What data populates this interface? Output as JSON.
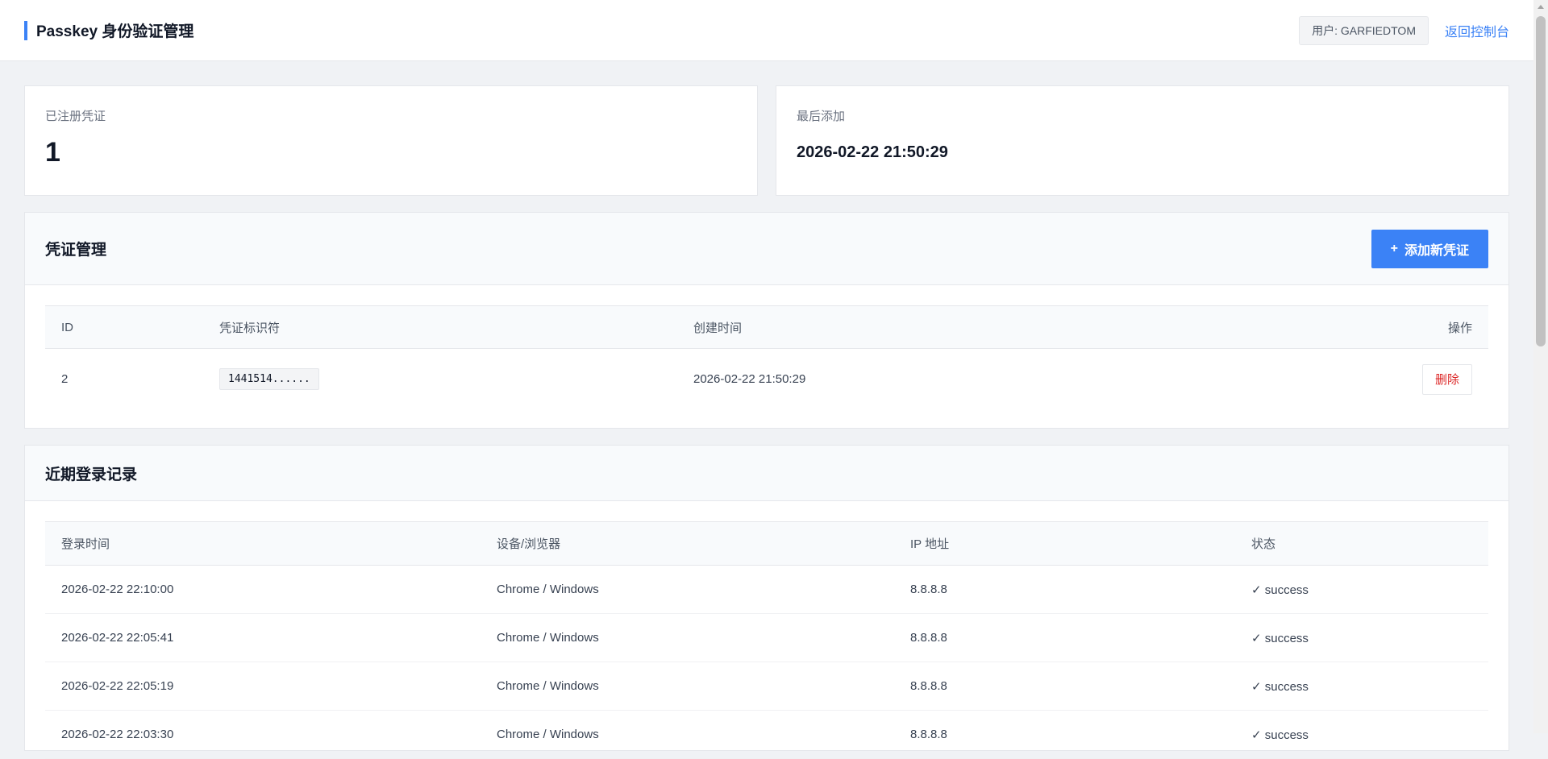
{
  "header": {
    "title": "Passkey 身份验证管理",
    "user_label": "用户: GARFIEDTOM",
    "back_link": "返回控制台"
  },
  "stats": {
    "registered": {
      "label": "已注册凭证",
      "value": "1"
    },
    "last_added": {
      "label": "最后添加",
      "value": "2026-02-22 21:50:29"
    }
  },
  "credentials": {
    "title": "凭证管理",
    "add_button": "添加新凭证",
    "add_icon": "+",
    "columns": [
      "ID",
      "凭证标识符",
      "创建时间",
      "操作"
    ],
    "rows": [
      {
        "id": "2",
        "identifier": "1441514......",
        "created": "2026-02-22 21:50:29",
        "action": "删除"
      }
    ]
  },
  "logins": {
    "title": "近期登录记录",
    "columns": [
      "登录时间",
      "设备/浏览器",
      "IP 地址",
      "状态"
    ],
    "rows": [
      {
        "time": "2026-02-22 22:10:00",
        "device": "Chrome / Windows",
        "ip": "8.8.8.8",
        "status": "✓ success"
      },
      {
        "time": "2026-02-22 22:05:41",
        "device": "Chrome / Windows",
        "ip": "8.8.8.8",
        "status": "✓ success"
      },
      {
        "time": "2026-02-22 22:05:19",
        "device": "Chrome / Windows",
        "ip": "8.8.8.8",
        "status": "✓ success"
      },
      {
        "time": "2026-02-22 22:03:30",
        "device": "Chrome / Windows",
        "ip": "8.8.8.8",
        "status": "✓ success"
      }
    ]
  },
  "colors": {
    "accent": "#3b82f6",
    "danger": "#dc2626",
    "success": "#10b981"
  }
}
